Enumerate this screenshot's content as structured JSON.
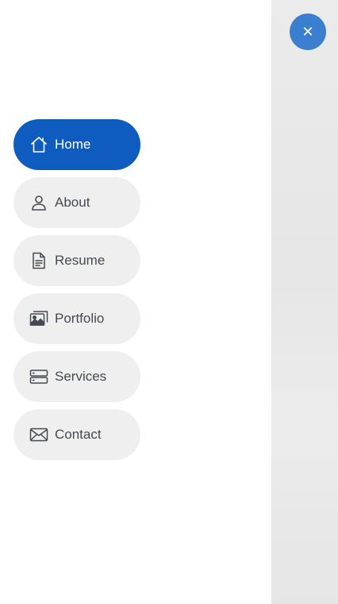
{
  "close_button": {
    "icon": "close-icon",
    "glyph": "✕"
  },
  "nav": {
    "active": "Home",
    "items": [
      {
        "label": "Home",
        "icon": "home-icon"
      },
      {
        "label": "About",
        "icon": "person-icon"
      },
      {
        "label": "Resume",
        "icon": "file-text-icon"
      },
      {
        "label": "Portfolio",
        "icon": "images-icon"
      },
      {
        "label": "Services",
        "icon": "server-icon"
      },
      {
        "label": "Contact",
        "icon": "envelope-icon"
      }
    ]
  },
  "colors": {
    "active_bg": "#0e5cbf",
    "inactive_bg": "#efefef",
    "close_bg": "#3a7fd0",
    "text": "#444a52"
  }
}
